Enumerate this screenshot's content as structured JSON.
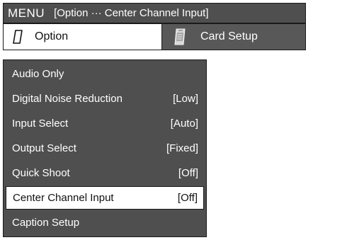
{
  "header": {
    "title": "MENU",
    "breadcrumb": "[Option ··· Center Channel Input]"
  },
  "tabs": [
    {
      "label": "Option",
      "icon": "option-card-icon",
      "active": true
    },
    {
      "label": "Card Setup",
      "icon": "card-setup-icon",
      "active": false
    }
  ],
  "menu": {
    "items": [
      {
        "label": "Audio Only",
        "value": ""
      },
      {
        "label": "Digital Noise Reduction",
        "value": "[Low]"
      },
      {
        "label": "Input Select",
        "value": "[Auto]"
      },
      {
        "label": "Output Select",
        "value": "[Fixed]"
      },
      {
        "label": "Quick Shoot",
        "value": "[Off]"
      },
      {
        "label": "Center Channel Input",
        "value": "[Off]",
        "selected": true
      },
      {
        "label": "Caption Setup",
        "value": ""
      }
    ]
  },
  "colors": {
    "panel": "#4f4f4f",
    "inactive_tab": "#585858",
    "selected": "#ffffff",
    "text_light": "#ffffff",
    "text_dark": "#111111"
  }
}
